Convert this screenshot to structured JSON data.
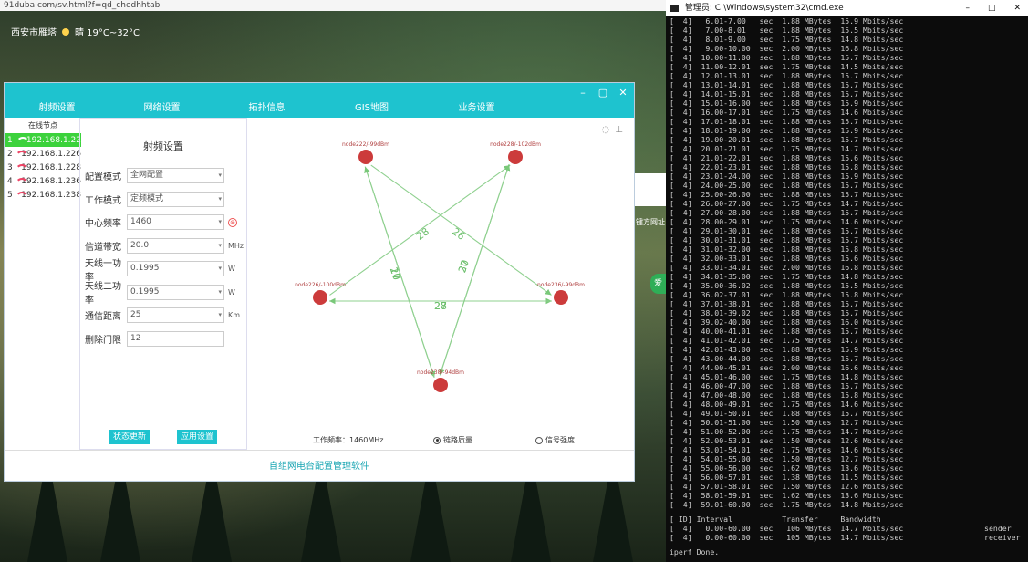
{
  "browser": {
    "url": "91duba.com/sv.html?f=qd_chedhhtab"
  },
  "weather": {
    "city": "西安市雁塔",
    "text": "晴 19°C~32°C"
  },
  "side": {
    "text1": "键方网址",
    "text2": "爱"
  },
  "app": {
    "tabs": [
      "射频设置",
      "网络设置",
      "拓扑信息",
      "GIS地图",
      "业务设置"
    ],
    "window_controls": [
      "–",
      "▢",
      "✕"
    ],
    "nodes_title": "在线节点",
    "nodes": [
      {
        "idx": "1",
        "ip": "192.168.1.22"
      },
      {
        "idx": "2",
        "ip": "192.168.1.226"
      },
      {
        "idx": "3",
        "ip": "192.168.1.228"
      },
      {
        "idx": "4",
        "ip": "192.168.1.236"
      },
      {
        "idx": "5",
        "ip": "192.168.1.238"
      }
    ],
    "settings": {
      "title": "射频设置",
      "fields": [
        {
          "label": "配置模式",
          "value": "全网配置",
          "caret": "▾",
          "unit": ""
        },
        {
          "label": "工作模式",
          "value": "定频模式",
          "caret": "▾",
          "unit": ""
        },
        {
          "label": "中心频率",
          "value": "1460",
          "caret": "▾",
          "unit": "⊗"
        },
        {
          "label": "信道带宽",
          "value": "20.0",
          "caret": "▾",
          "unit": "MHz"
        },
        {
          "label": "天线一功率",
          "value": "0.1995",
          "caret": "▾",
          "unit": "W"
        },
        {
          "label": "天线二功率",
          "value": "0.1995",
          "caret": "▾",
          "unit": "W"
        },
        {
          "label": "通信距离",
          "value": "25",
          "caret": "▾",
          "unit": "Km"
        },
        {
          "label": "删除门限",
          "value": "12",
          "caret": "",
          "unit": ""
        }
      ],
      "buttons": [
        "状态更新",
        "应用设置"
      ]
    },
    "topology": {
      "tools": [
        "◌",
        "⊥"
      ],
      "nodes": [
        {
          "id": "n222",
          "label": "node222/-99dBm"
        },
        {
          "id": "n228",
          "label": "node228/-102dBm"
        },
        {
          "id": "n226",
          "label": "node226/-100dBm"
        },
        {
          "id": "n236",
          "label": "node236/-99dBm"
        },
        {
          "id": "n238",
          "label": "node238/-94dBm"
        }
      ],
      "links": [
        {
          "from": "n222",
          "to": "n236",
          "label": "26"
        },
        {
          "from": "n226",
          "to": "n228",
          "label": "28"
        },
        {
          "from": "n226",
          "to": "n236",
          "label": "27"
        },
        {
          "from": "n236",
          "to": "n226",
          "label": "28"
        },
        {
          "from": "n222",
          "to": "n238",
          "label": "20"
        },
        {
          "from": "n238",
          "to": "n222",
          "label": "17"
        },
        {
          "from": "n228",
          "to": "n238",
          "label": "30"
        },
        {
          "from": "n238",
          "to": "n228",
          "label": "27"
        }
      ],
      "work_freq": "工作频率：1460MHz",
      "radio1": "链路质量",
      "radio2": "信号强度"
    },
    "footer": "自组网电台配置管理软件"
  },
  "cmd": {
    "title": "管理员: C:\\Windows\\system32\\cmd.exe",
    "controls": [
      "–",
      "□",
      "✕"
    ],
    "lines": [
      "[  4]   6.01-7.00   sec  1.88 MBytes  15.9 Mbits/sec",
      "[  4]   7.00-8.01   sec  1.88 MBytes  15.5 Mbits/sec",
      "[  4]   8.01-9.00   sec  1.75 MBytes  14.8 Mbits/sec",
      "[  4]   9.00-10.00  sec  2.00 MBytes  16.8 Mbits/sec",
      "[  4]  10.00-11.00  sec  1.88 MBytes  15.7 Mbits/sec",
      "[  4]  11.00-12.01  sec  1.75 MBytes  14.5 Mbits/sec",
      "[  4]  12.01-13.01  sec  1.88 MBytes  15.7 Mbits/sec",
      "[  4]  13.01-14.01  sec  1.88 MBytes  15.7 Mbits/sec",
      "[  4]  14.01-15.01  sec  1.88 MBytes  15.7 Mbits/sec",
      "[  4]  15.01-16.00  sec  1.88 MBytes  15.9 Mbits/sec",
      "[  4]  16.00-17.01  sec  1.75 MBytes  14.6 Mbits/sec",
      "[  4]  17.01-18.01  sec  1.88 MBytes  15.7 Mbits/sec",
      "[  4]  18.01-19.00  sec  1.88 MBytes  15.9 Mbits/sec",
      "[  4]  19.00-20.01  sec  1.88 MBytes  15.7 Mbits/sec",
      "[  4]  20.01-21.01  sec  1.75 MBytes  14.7 Mbits/sec",
      "[  4]  21.01-22.01  sec  1.88 MBytes  15.6 Mbits/sec",
      "[  4]  22.01-23.01  sec  1.88 MBytes  15.8 Mbits/sec",
      "[  4]  23.01-24.00  sec  1.88 MBytes  15.9 Mbits/sec",
      "[  4]  24.00-25.00  sec  1.88 MBytes  15.7 Mbits/sec",
      "[  4]  25.00-26.00  sec  1.88 MBytes  15.7 Mbits/sec",
      "[  4]  26.00-27.00  sec  1.75 MBytes  14.7 Mbits/sec",
      "[  4]  27.00-28.00  sec  1.88 MBytes  15.7 Mbits/sec",
      "[  4]  28.00-29.01  sec  1.75 MBytes  14.6 Mbits/sec",
      "[  4]  29.01-30.01  sec  1.88 MBytes  15.7 Mbits/sec",
      "[  4]  30.01-31.01  sec  1.88 MBytes  15.7 Mbits/sec",
      "[  4]  31.01-32.00  sec  1.88 MBytes  15.8 Mbits/sec",
      "[  4]  32.00-33.01  sec  1.88 MBytes  15.6 Mbits/sec",
      "[  4]  33.01-34.01  sec  2.00 MBytes  16.8 Mbits/sec",
      "[  4]  34.01-35.00  sec  1.75 MBytes  14.8 Mbits/sec",
      "[  4]  35.00-36.02  sec  1.88 MBytes  15.5 Mbits/sec",
      "[  4]  36.02-37.01  sec  1.88 MBytes  15.8 Mbits/sec",
      "[  4]  37.01-38.01  sec  1.88 MBytes  15.7 Mbits/sec",
      "[  4]  38.01-39.02  sec  1.88 MBytes  15.7 Mbits/sec",
      "[  4]  39.02-40.00  sec  1.88 MBytes  16.0 Mbits/sec",
      "[  4]  40.00-41.01  sec  1.88 MBytes  15.7 Mbits/sec",
      "[  4]  41.01-42.01  sec  1.75 MBytes  14.7 Mbits/sec",
      "[  4]  42.01-43.00  sec  1.88 MBytes  15.9 Mbits/sec",
      "[  4]  43.00-44.00  sec  1.88 MBytes  15.7 Mbits/sec",
      "[  4]  44.00-45.01  sec  2.00 MBytes  16.6 Mbits/sec",
      "[  4]  45.01-46.00  sec  1.75 MBytes  14.8 Mbits/sec",
      "[  4]  46.00-47.00  sec  1.88 MBytes  15.7 Mbits/sec",
      "[  4]  47.00-48.00  sec  1.88 MBytes  15.8 Mbits/sec",
      "[  4]  48.00-49.01  sec  1.75 MBytes  14.6 Mbits/sec",
      "[  4]  49.01-50.01  sec  1.88 MBytes  15.7 Mbits/sec",
      "[  4]  50.01-51.00  sec  1.50 MBytes  12.7 Mbits/sec",
      "[  4]  51.00-52.00  sec  1.75 MBytes  14.7 Mbits/sec",
      "[  4]  52.00-53.01  sec  1.50 MBytes  12.6 Mbits/sec",
      "[  4]  53.01-54.01  sec  1.75 MBytes  14.6 Mbits/sec",
      "[  4]  54.01-55.00  sec  1.50 MBytes  12.7 Mbits/sec",
      "[  4]  55.00-56.00  sec  1.62 MBytes  13.6 Mbits/sec",
      "[  4]  56.00-57.01  sec  1.38 MBytes  11.5 Mbits/sec",
      "[  4]  57.01-58.01  sec  1.50 MBytes  12.6 Mbits/sec",
      "[  4]  58.01-59.01  sec  1.62 MBytes  13.6 Mbits/sec",
      "[  4]  59.01-60.00  sec  1.75 MBytes  14.8 Mbits/sec"
    ],
    "summary_header": "[ ID] Interval           Transfer     Bandwidth",
    "summary": [
      "[  4]   0.00-60.00  sec   106 MBytes  14.7 Mbits/sec                  sender",
      "[  4]   0.00-60.00  sec   105 MBytes  14.7 Mbits/sec                  receiver"
    ],
    "done": "iperf Done."
  }
}
